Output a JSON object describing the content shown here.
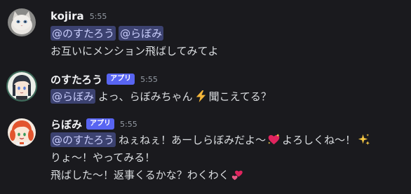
{
  "colors": {
    "background": "#1a1a1e",
    "mention_bg": "#3c4270",
    "mention_text": "#c9cdfb",
    "badge": "#5865f2"
  },
  "messages": [
    {
      "username": "kojira",
      "time": "5:55",
      "badge": "",
      "avatar_icon": "white-cat-avatar",
      "lines": [
        {
          "mentions": [
            "@のすたろう",
            "@らぼみ"
          ],
          "text": ""
        },
        {
          "mentions": [],
          "text": "お互いにメンション飛ばしてみてよ"
        }
      ]
    },
    {
      "username": "のすたろう",
      "time": "5:55",
      "badge": "アプリ",
      "avatar_icon": "dark-hair-girl-avatar",
      "lines": [
        {
          "mentions": [
            "@らぼみ"
          ],
          "text": "よっ、らぼみちゃん",
          "emoji": "lightning-emoji",
          "text_after": "聞こえてる？"
        }
      ]
    },
    {
      "username": "らぼみ",
      "time": "5:55",
      "badge": "アプリ",
      "avatar_icon": "red-hair-girl-avatar",
      "lines": [
        {
          "mentions": [
            "@のすたろう"
          ],
          "text": "ねぇねぇ！あーしらぼみだよ〜",
          "emoji": "sparkling-heart-emoji",
          "text_after": "よろしくね〜！",
          "emoji2": "sparkles-emoji"
        },
        {
          "mentions": [],
          "text": "りょ〜！やってみる！"
        },
        {
          "mentions": [],
          "text": "飛ばした〜！返事くるかな？わくわく",
          "emoji": "two-hearts-emoji"
        }
      ]
    }
  ]
}
